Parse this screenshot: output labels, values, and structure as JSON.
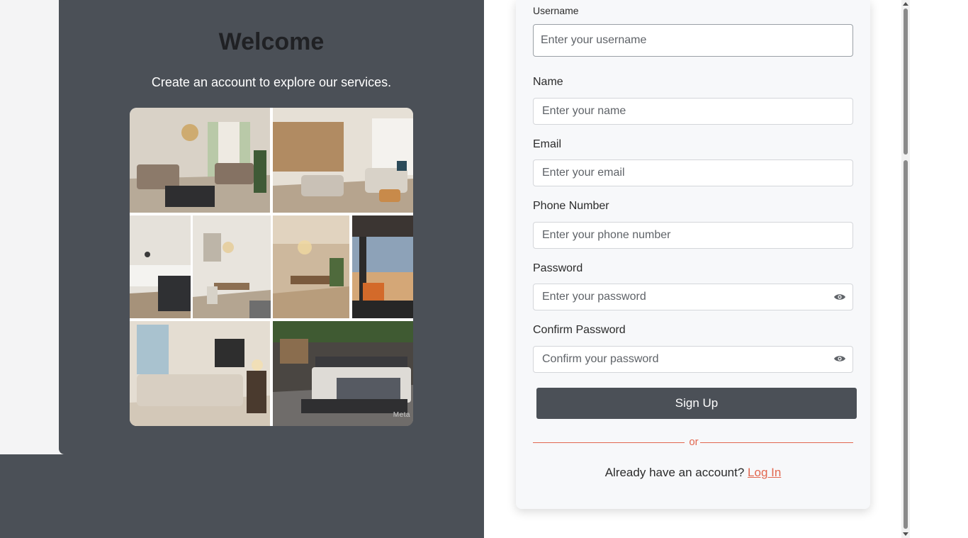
{
  "welcome": {
    "title": "Welcome",
    "subtitle": "Create an account to explore our services.",
    "watermark": "Meta"
  },
  "form": {
    "username": {
      "label": "Username",
      "placeholder": "Enter your username"
    },
    "name": {
      "label": "Name",
      "placeholder": "Enter your name"
    },
    "email": {
      "label": "Email",
      "placeholder": "Enter your email"
    },
    "phone": {
      "label": "Phone Number",
      "placeholder": "Enter your phone number"
    },
    "password": {
      "label": "Password",
      "placeholder": "Enter your password"
    },
    "confirm": {
      "label": "Confirm Password",
      "placeholder": "Confirm your password"
    },
    "submit_label": "Sign Up",
    "divider_text": "or",
    "login_prompt": "Already have an account?",
    "login_link": "Log In"
  },
  "colors": {
    "panel": "#4b5057",
    "accent": "#e2674f",
    "card": "#f7f8fa"
  },
  "icons": [
    "eye-icon",
    "eye-icon"
  ]
}
